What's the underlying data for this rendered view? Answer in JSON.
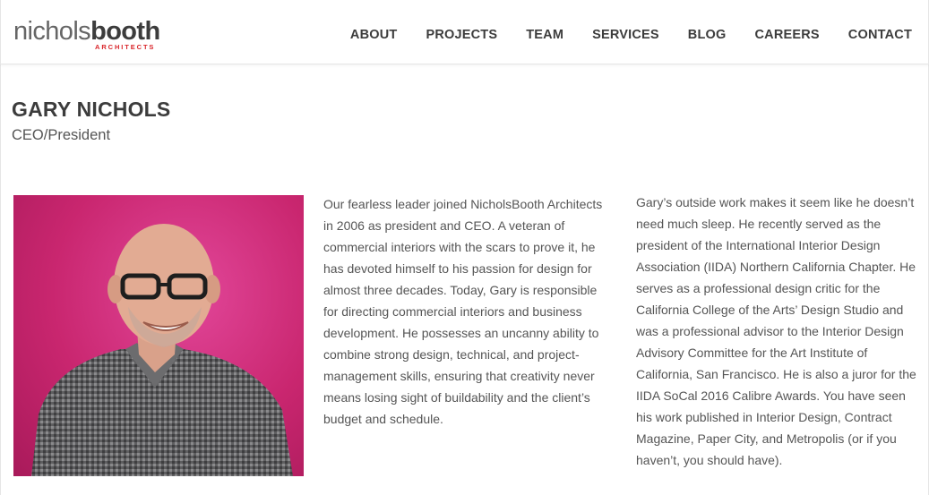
{
  "brand": {
    "logo_main_light": "nichols",
    "logo_main_bold": "booth",
    "logo_sub": "ARCHITECTS",
    "accent_color": "#d9252a"
  },
  "nav": {
    "items": [
      {
        "label": "ABOUT"
      },
      {
        "label": "PROJECTS"
      },
      {
        "label": "TEAM"
      },
      {
        "label": "SERVICES"
      },
      {
        "label": "BLOG"
      },
      {
        "label": "CAREERS"
      },
      {
        "label": "CONTACT"
      }
    ]
  },
  "profile": {
    "name": "GARY NICHOLS",
    "role": "CEO/President",
    "bio_left": "Our fearless leader joined NicholsBooth Architects in 2006 as president and CEO. A veteran of commercial interiors with the scars to prove it, he has devoted himself to his passion for design for almost three decades. Today, Gary is responsible for directing commercial interiors and business development. He possesses an uncanny ability to combine strong design, technical, and project-management skills, ensuring that creativity never means losing sight of buildability and the client’s budget and schedule.",
    "bio_right": "Gary’s outside work makes it seem like he doesn’t need much sleep. He recently served as the president of the International Interior Design Association (IIDA) Northern California Chapter. He serves as a professional design critic for the California College of the Arts’ Design Studio and was a professional advisor to the Interior Design Advisory Committee for the Art Institute of California, San Francisco. He is also a juror for the IIDA SoCal 2016 Calibre Awards. You have seen his work published in Interior Design, Contract Magazine, Paper City, and Metropolis (or if you haven’t, you should have)."
  }
}
